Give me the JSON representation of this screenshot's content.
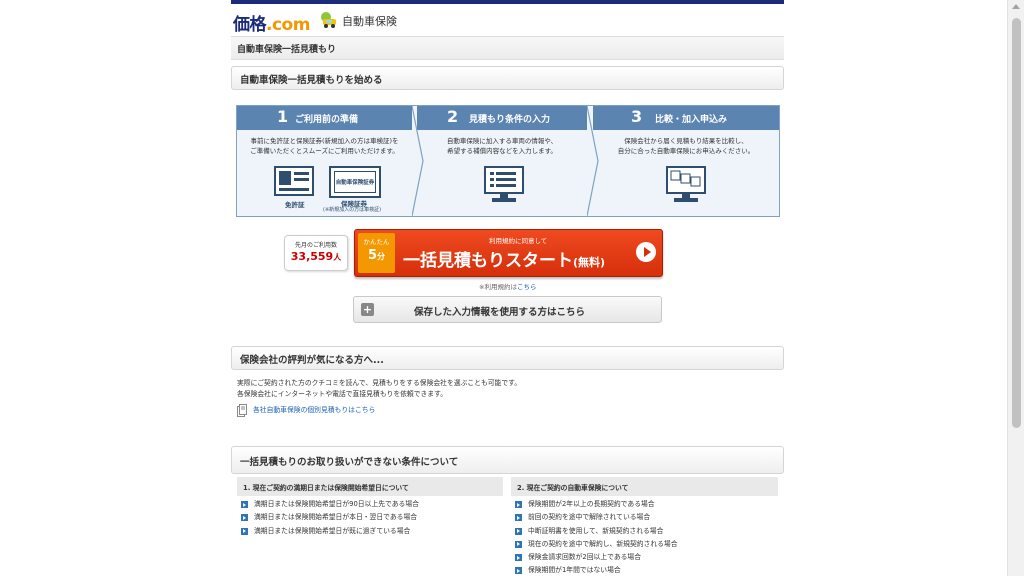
{
  "header": {
    "logo_main": "価格",
    "logo_domain": ".com",
    "service_name": "自動車保険"
  },
  "breadcrumb": {
    "title": "自動車保険一括見積もり"
  },
  "start_section": {
    "title": "自動車保険一括見積もりを始める"
  },
  "steps": [
    {
      "num": "1",
      "title": "ご利用前の準備",
      "desc": "事前に免許証と保険証券(新規加入の方は車検証)を\nご準備いただくとスムーズにご利用いただけます。",
      "caption1": "免許証",
      "caption2": "保険証券",
      "caption2_note": "(※新規加入の方は車検証)",
      "doc_label": "自動車保険証券"
    },
    {
      "num": "2",
      "title": "見積もり条件の入力",
      "desc": "自動車保険に加入する車両の情報や、\n希望する補償内容などを入力します。"
    },
    {
      "num": "3",
      "title": "比較・加入申込み",
      "desc": "保険会社から届く見積もり結果を比較し、\n自分に合った自動車保険にお申込みください。"
    }
  ],
  "users": {
    "label": "先月のご利用数",
    "count": "33,559",
    "unit": "人"
  },
  "cta": {
    "easy": "かんたん",
    "minutes": "5",
    "minutes_unit": "分",
    "agree": "利用規約に同意して",
    "main": "一括見積もりスタート",
    "main_suffix": "(無料)"
  },
  "terms": {
    "prefix": "※利用規約は",
    "link": "こちら"
  },
  "saved": {
    "label": "保存した入力情報を使用する方はこちら"
  },
  "reviews": {
    "title": "保険会社の評判が気になる方へ...",
    "line1": "実際にご契約された方のクチコミを読んで、見積もりをする保険会社を選ぶことも可能です。",
    "line2": "各保険会社にインターネットや電話で直接見積もりを依頼できます。",
    "link": "各社自動車保険の個別見積もりはこちら"
  },
  "conditions": {
    "title": "一括見積もりのお取り扱いができない条件について",
    "left": {
      "title": "1. 現在ご契約の満期日または保険開始希望日について",
      "items": [
        "満期日または保険開始希望日が90日以上先である場合",
        "満期日または保険開始希望日が本日・翌日である場合",
        "満期日または保険開始希望日が既に過ぎている場合"
      ]
    },
    "right": {
      "title": "2. 現在ご契約の自動車保険について",
      "items": [
        "保険期間が2年以上の長期契約である場合",
        "前回の契約を途中で解除されている場合",
        "中断証明書を使用して、新規契約される場合",
        "現在の契約を途中で解約し、新規契約される場合",
        "保険金請求回数が2回以上である場合",
        "保険期間が1年間ではない場合"
      ]
    }
  },
  "colors": {
    "brand": "#1b2a7b",
    "step_header": "#5b84b1",
    "cta": "#e03a14",
    "accent": "#f39800"
  }
}
